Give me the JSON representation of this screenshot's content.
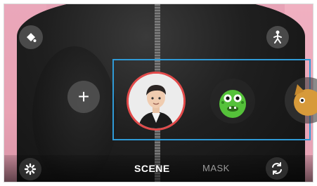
{
  "camera": {
    "tabs": [
      {
        "label": "SCENE",
        "active": true
      },
      {
        "label": "MASK",
        "active": false
      }
    ],
    "add_label": "+",
    "emojis": [
      {
        "icon": "human-avatar-icon",
        "selected": true
      },
      {
        "icon": "green-dinosaur-icon",
        "selected": false
      },
      {
        "icon": "cat-icon",
        "selected": false
      }
    ]
  },
  "colors": {
    "highlight": "#2f9ad6",
    "selected_ring": "#e24a4a",
    "dino": "#55c23a"
  }
}
